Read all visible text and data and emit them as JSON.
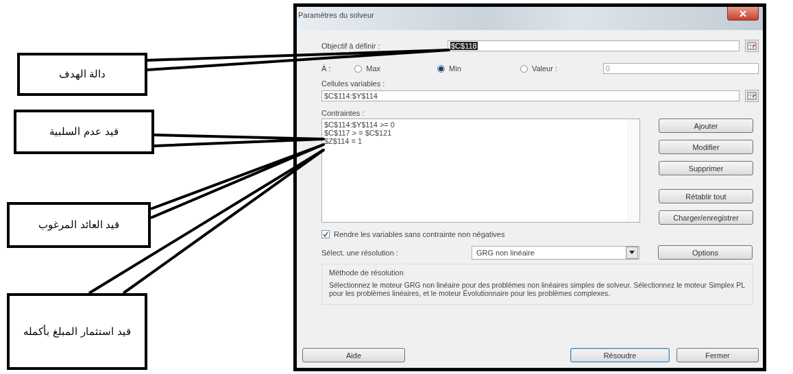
{
  "callouts": [
    {
      "text": "دالة الهدف"
    },
    {
      "text": "قيد عدم السلبية"
    },
    {
      "text": "قيد العائد المرغوب"
    },
    {
      "text": "قيد استثمار المبلغ بأكمله"
    }
  ],
  "dialog": {
    "title": "Paramètres du solveur",
    "objective": {
      "label": "Objectif à définir :",
      "value": "$C$118"
    },
    "to": {
      "label": "À :",
      "options": [
        {
          "label": "Max",
          "selected": false
        },
        {
          "label": "Min",
          "selected": true
        },
        {
          "label": "Valeur :",
          "selected": false
        }
      ],
      "value": "0",
      "value_disabled": true
    },
    "variable_cells": {
      "label": "Cellules variables :",
      "value": "$C$114:$Y$114"
    },
    "constraints": {
      "label": "Contraintes :",
      "items": [
        "$C$114:$Y$114 >= 0",
        "$C$117 > = $C$121",
        "$Z$114 = 1"
      ]
    },
    "side_buttons": [
      "Ajouter",
      "Modifier",
      "Supprimer",
      "Rétablir tout",
      "Charger/enregistrer"
    ],
    "nonneg": {
      "label": "Rendre les variables sans contrainte non négatives",
      "checked": true
    },
    "method": {
      "label": "Sélect. une résolution :",
      "value": "GRG non linéaire"
    },
    "options_button": "Options",
    "help": {
      "title": "Méthode de résolution",
      "text": "Sélectionnez le moteur GRG non linéaire pour des problèmes non linéaires simples de solveur. Sélectionnez le moteur Simplex PL pour les problèmes linéaires, et le moteur Évolutionnaire pour les problèmes complexes."
    },
    "footer_buttons": [
      "Aide",
      "Résoudre",
      "Fermer"
    ]
  }
}
